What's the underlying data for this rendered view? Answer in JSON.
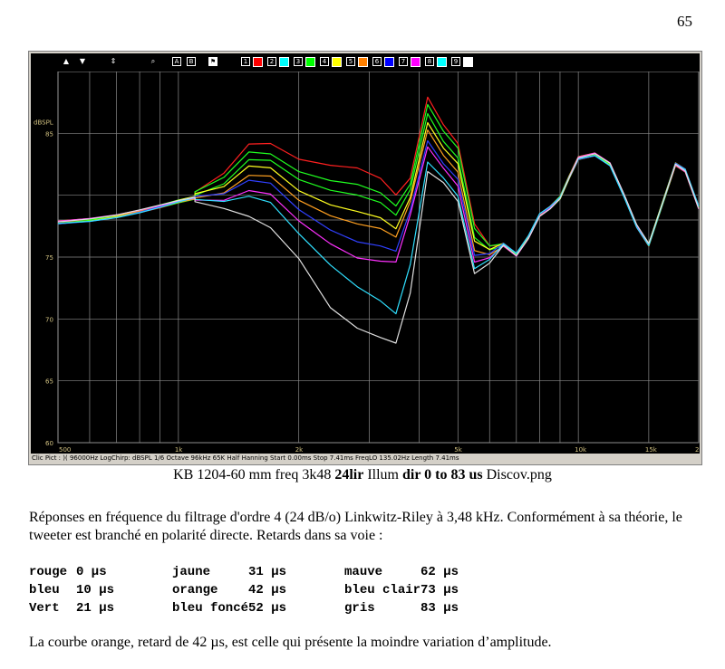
{
  "page_number": "65",
  "screenshot": {
    "toolbar": {
      "buttons": [
        "up-arrow",
        "down-arrow",
        "split-arrow",
        "zoom",
        "A",
        "B",
        "flag"
      ],
      "curve_buttons": [
        {
          "num": "1",
          "color": "#ff0000"
        },
        {
          "num": "2",
          "color": "#00ffff"
        },
        {
          "num": "3",
          "color": "#00ff00"
        },
        {
          "num": "4",
          "color": "#ffff00"
        },
        {
          "num": "5",
          "color": "#ff8000"
        },
        {
          "num": "6",
          "color": "#0000ff"
        },
        {
          "num": "7",
          "color": "#ff00ff"
        },
        {
          "num": "8",
          "color": "#00ffff"
        },
        {
          "num": "9",
          "color": "#ffffff"
        }
      ]
    },
    "status_bar": "Clic Pict : )( 96000Hz  LogChirp: dBSPL  1/6 Octave  96kHz  65K  Half Hanning  Start 0.00ms  Stop 7.41ms  FreqLO 135.02Hz  Length 7.41ms"
  },
  "chart_data": {
    "type": "line",
    "x_scale": "log",
    "xlim": [
      500,
      20000
    ],
    "ylim": [
      60,
      90
    ],
    "ylabel": "dBSPL",
    "y_ticks": [
      "85",
      "75",
      "70",
      "65",
      "60"
    ],
    "x_ticks": [
      {
        "v": 500,
        "label": "500"
      },
      {
        "v": 1000,
        "label": "1k"
      },
      {
        "v": 2000,
        "label": "2k"
      },
      {
        "v": 5000,
        "label": "5k"
      },
      {
        "v": 10000,
        "label": "10k"
      },
      {
        "v": 15000,
        "label": "15k"
      },
      {
        "v": 20000,
        "label": "20k"
      }
    ],
    "x_grid": [
      600,
      700,
      800,
      900,
      1000,
      2000,
      3000,
      4000,
      5000,
      6000,
      7000,
      8000,
      9000,
      10000,
      15000,
      20000
    ],
    "y_grid": [
      60,
      65,
      70,
      75,
      78,
      80,
      85,
      90
    ],
    "common_low": {
      "x": [
        500,
        600,
        700,
        800,
        900,
        1000,
        1100
      ],
      "y": [
        77.8,
        78.0,
        78.3,
        78.7,
        79.1,
        79.5,
        79.8
      ]
    },
    "common_high": {
      "x": [
        6500,
        7000,
        7500,
        8000,
        8500,
        9000,
        9500,
        10000,
        11000,
        12000,
        13000,
        14000,
        15000,
        16500,
        17500,
        18500,
        20000
      ],
      "y": [
        76.0,
        75.2,
        76.6,
        78.4,
        79.0,
        79.8,
        81.5,
        83.0,
        83.3,
        82.5,
        80.0,
        77.5,
        76.0,
        80.0,
        82.5,
        82.0,
        79.0
      ]
    },
    "series": [
      {
        "delay": "0 µs",
        "color": "#ff2020",
        "x": [
          1100,
          1300,
          1500,
          1700,
          2000,
          2400,
          2800,
          3200,
          3500,
          3800,
          4200,
          4600,
          5000,
          5500,
          6000
        ],
        "y": [
          80.3,
          81.8,
          84.1,
          84.1,
          82.8,
          82.3,
          82.1,
          81.3,
          80.0,
          81.4,
          88.0,
          85.8,
          84.3,
          77.8,
          76.0
        ]
      },
      {
        "delay": "10 µs",
        "color": "#20ff20",
        "x": [
          1100,
          1300,
          1500,
          1700,
          2000,
          2400,
          2800,
          3200,
          3500,
          3800,
          4200,
          4600,
          5000,
          5500,
          6000
        ],
        "y": [
          80.2,
          81.4,
          83.5,
          83.4,
          82.0,
          81.3,
          81.0,
          80.3,
          79.2,
          80.9,
          87.3,
          85.1,
          83.7,
          77.2,
          75.8
        ]
      },
      {
        "delay": "21 µs",
        "color": "#20ff20",
        "x": [
          1100,
          1300,
          1500,
          1700,
          2000,
          2400,
          2800,
          3200,
          3500,
          3800,
          4200,
          4600,
          5000,
          5500,
          6000
        ],
        "y": [
          80.1,
          81.0,
          82.9,
          82.8,
          81.2,
          80.3,
          79.9,
          79.3,
          78.3,
          80.4,
          86.6,
          84.4,
          83.1,
          76.7,
          75.7
        ]
      },
      {
        "delay": "31 µs",
        "color": "#ffff20",
        "x": [
          1100,
          1300,
          1500,
          1700,
          2000,
          2400,
          2800,
          3200,
          3500,
          3800,
          4200,
          4600,
          5000,
          5500,
          6000
        ],
        "y": [
          80.0,
          80.6,
          82.3,
          82.2,
          80.4,
          79.3,
          78.8,
          78.3,
          77.4,
          79.9,
          85.9,
          83.8,
          82.5,
          76.2,
          75.5
        ]
      },
      {
        "delay": "42 µs",
        "color": "#ffa020",
        "x": [
          1100,
          1300,
          1500,
          1700,
          2000,
          2400,
          2800,
          3200,
          3500,
          3800,
          4200,
          4600,
          5000,
          5500,
          6000
        ],
        "y": [
          79.9,
          80.3,
          81.7,
          81.6,
          79.6,
          78.3,
          77.6,
          77.2,
          76.5,
          79.4,
          85.2,
          83.2,
          81.9,
          75.6,
          75.3
        ]
      },
      {
        "delay": "52 µs",
        "color": "#3040ff",
        "x": [
          1100,
          1300,
          1500,
          1700,
          2000,
          2400,
          2800,
          3200,
          3500,
          3800,
          4200,
          4600,
          5000,
          5500,
          6000
        ],
        "y": [
          79.8,
          80.0,
          81.1,
          80.9,
          78.8,
          77.2,
          76.3,
          76.0,
          75.6,
          78.9,
          84.5,
          82.6,
          81.3,
          75.1,
          75.2
        ]
      },
      {
        "delay": "62 µs",
        "color": "#ff30ff",
        "x": [
          1100,
          1300,
          1500,
          1700,
          2000,
          2400,
          2800,
          3200,
          3500,
          3800,
          4200,
          4600,
          5000,
          5500,
          6000
        ],
        "y": [
          79.7,
          79.7,
          80.5,
          80.2,
          78.0,
          76.1,
          74.9,
          74.6,
          74.5,
          78.3,
          83.8,
          82.1,
          80.7,
          74.6,
          75.0
        ]
      },
      {
        "delay": "73 µs",
        "color": "#30e0ff",
        "x": [
          1100,
          1300,
          1500,
          1700,
          2000,
          2400,
          2800,
          3200,
          3500,
          3800,
          4200,
          4600,
          5000,
          5500,
          6000
        ],
        "y": [
          79.6,
          79.4,
          79.8,
          79.3,
          76.8,
          74.3,
          72.6,
          71.5,
          70.5,
          74.5,
          82.8,
          81.5,
          80.0,
          74.1,
          74.8
        ]
      },
      {
        "delay": "83 µs",
        "color": "#e0e0e0",
        "x": [
          1100,
          1300,
          1500,
          1700,
          2000,
          2400,
          2800,
          3200,
          3500,
          3800,
          4200,
          4600,
          5000,
          5500,
          6000
        ],
        "y": [
          79.5,
          79.0,
          78.4,
          77.5,
          75.0,
          71.0,
          69.3,
          68.5,
          68.0,
          72.0,
          81.8,
          80.9,
          79.4,
          73.6,
          74.5
        ]
      }
    ]
  },
  "caption": {
    "prefix": "KB 1204-60 mm freq 3k48 ",
    "bold1": "24lir",
    "middle": " Illum ",
    "bold2": "dir 0 to 83 us",
    "suffix": " Discov.png"
  },
  "paragraph1": "Réponses en fréquence du filtrage d'ordre 4 (24 dB/o) Linkwitz-Riley à 3,48 kHz. Conformément à sa théorie, le tweeter est branché en polarité directe. Retards dans sa voie :",
  "delays_table": [
    [
      "rouge",
      "0 µs",
      "jaune",
      "31 µs",
      "mauve",
      "62 µs"
    ],
    [
      "bleu",
      "10 µs",
      "orange",
      "42 µs",
      "bleu clair",
      "73 µs"
    ],
    [
      "Vert",
      "21 µs",
      "bleu foncé",
      "52 µs",
      "gris",
      "83 µs"
    ]
  ],
  "paragraph2": "La courbe orange, retard de 42 µs, est celle qui présente la moindre variation d’amplitude."
}
